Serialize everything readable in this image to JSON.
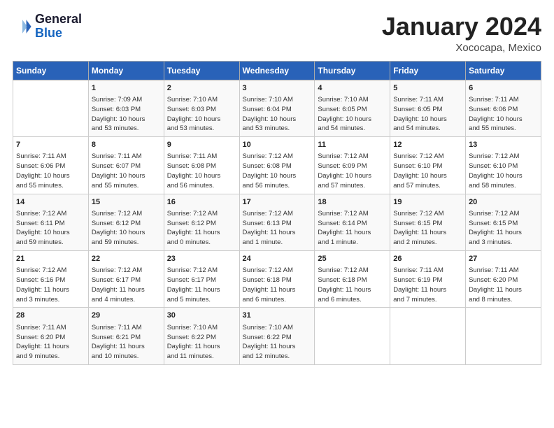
{
  "header": {
    "logo_line1": "General",
    "logo_line2": "Blue",
    "main_title": "January 2024",
    "sub_title": "Xococapa, Mexico"
  },
  "days_of_week": [
    "Sunday",
    "Monday",
    "Tuesday",
    "Wednesday",
    "Thursday",
    "Friday",
    "Saturday"
  ],
  "weeks": [
    [
      {
        "num": "",
        "info": ""
      },
      {
        "num": "1",
        "info": "Sunrise: 7:09 AM\nSunset: 6:03 PM\nDaylight: 10 hours\nand 53 minutes."
      },
      {
        "num": "2",
        "info": "Sunrise: 7:10 AM\nSunset: 6:03 PM\nDaylight: 10 hours\nand 53 minutes."
      },
      {
        "num": "3",
        "info": "Sunrise: 7:10 AM\nSunset: 6:04 PM\nDaylight: 10 hours\nand 53 minutes."
      },
      {
        "num": "4",
        "info": "Sunrise: 7:10 AM\nSunset: 6:05 PM\nDaylight: 10 hours\nand 54 minutes."
      },
      {
        "num": "5",
        "info": "Sunrise: 7:11 AM\nSunset: 6:05 PM\nDaylight: 10 hours\nand 54 minutes."
      },
      {
        "num": "6",
        "info": "Sunrise: 7:11 AM\nSunset: 6:06 PM\nDaylight: 10 hours\nand 55 minutes."
      }
    ],
    [
      {
        "num": "7",
        "info": "Sunrise: 7:11 AM\nSunset: 6:06 PM\nDaylight: 10 hours\nand 55 minutes."
      },
      {
        "num": "8",
        "info": "Sunrise: 7:11 AM\nSunset: 6:07 PM\nDaylight: 10 hours\nand 55 minutes."
      },
      {
        "num": "9",
        "info": "Sunrise: 7:11 AM\nSunset: 6:08 PM\nDaylight: 10 hours\nand 56 minutes."
      },
      {
        "num": "10",
        "info": "Sunrise: 7:12 AM\nSunset: 6:08 PM\nDaylight: 10 hours\nand 56 minutes."
      },
      {
        "num": "11",
        "info": "Sunrise: 7:12 AM\nSunset: 6:09 PM\nDaylight: 10 hours\nand 57 minutes."
      },
      {
        "num": "12",
        "info": "Sunrise: 7:12 AM\nSunset: 6:10 PM\nDaylight: 10 hours\nand 57 minutes."
      },
      {
        "num": "13",
        "info": "Sunrise: 7:12 AM\nSunset: 6:10 PM\nDaylight: 10 hours\nand 58 minutes."
      }
    ],
    [
      {
        "num": "14",
        "info": "Sunrise: 7:12 AM\nSunset: 6:11 PM\nDaylight: 10 hours\nand 59 minutes."
      },
      {
        "num": "15",
        "info": "Sunrise: 7:12 AM\nSunset: 6:12 PM\nDaylight: 10 hours\nand 59 minutes."
      },
      {
        "num": "16",
        "info": "Sunrise: 7:12 AM\nSunset: 6:12 PM\nDaylight: 11 hours\nand 0 minutes."
      },
      {
        "num": "17",
        "info": "Sunrise: 7:12 AM\nSunset: 6:13 PM\nDaylight: 11 hours\nand 1 minute."
      },
      {
        "num": "18",
        "info": "Sunrise: 7:12 AM\nSunset: 6:14 PM\nDaylight: 11 hours\nand 1 minute."
      },
      {
        "num": "19",
        "info": "Sunrise: 7:12 AM\nSunset: 6:15 PM\nDaylight: 11 hours\nand 2 minutes."
      },
      {
        "num": "20",
        "info": "Sunrise: 7:12 AM\nSunset: 6:15 PM\nDaylight: 11 hours\nand 3 minutes."
      }
    ],
    [
      {
        "num": "21",
        "info": "Sunrise: 7:12 AM\nSunset: 6:16 PM\nDaylight: 11 hours\nand 3 minutes."
      },
      {
        "num": "22",
        "info": "Sunrise: 7:12 AM\nSunset: 6:17 PM\nDaylight: 11 hours\nand 4 minutes."
      },
      {
        "num": "23",
        "info": "Sunrise: 7:12 AM\nSunset: 6:17 PM\nDaylight: 11 hours\nand 5 minutes."
      },
      {
        "num": "24",
        "info": "Sunrise: 7:12 AM\nSunset: 6:18 PM\nDaylight: 11 hours\nand 6 minutes."
      },
      {
        "num": "25",
        "info": "Sunrise: 7:12 AM\nSunset: 6:18 PM\nDaylight: 11 hours\nand 6 minutes."
      },
      {
        "num": "26",
        "info": "Sunrise: 7:11 AM\nSunset: 6:19 PM\nDaylight: 11 hours\nand 7 minutes."
      },
      {
        "num": "27",
        "info": "Sunrise: 7:11 AM\nSunset: 6:20 PM\nDaylight: 11 hours\nand 8 minutes."
      }
    ],
    [
      {
        "num": "28",
        "info": "Sunrise: 7:11 AM\nSunset: 6:20 PM\nDaylight: 11 hours\nand 9 minutes."
      },
      {
        "num": "29",
        "info": "Sunrise: 7:11 AM\nSunset: 6:21 PM\nDaylight: 11 hours\nand 10 minutes."
      },
      {
        "num": "30",
        "info": "Sunrise: 7:10 AM\nSunset: 6:22 PM\nDaylight: 11 hours\nand 11 minutes."
      },
      {
        "num": "31",
        "info": "Sunrise: 7:10 AM\nSunset: 6:22 PM\nDaylight: 11 hours\nand 12 minutes."
      },
      {
        "num": "",
        "info": ""
      },
      {
        "num": "",
        "info": ""
      },
      {
        "num": "",
        "info": ""
      }
    ]
  ]
}
